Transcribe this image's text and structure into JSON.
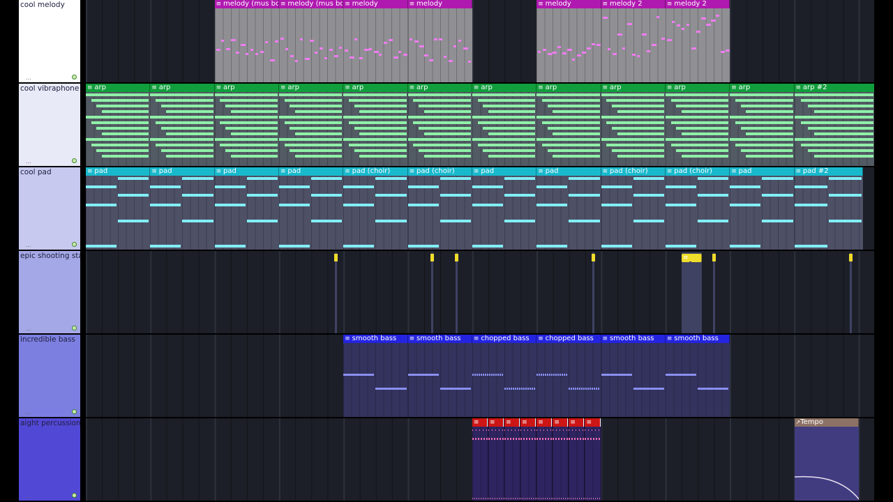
{
  "colors": {
    "melody_label": "#b019b0",
    "melody_body": "#8f8f94",
    "melody_note": "#f07cf0",
    "arp_label": "#119e3c",
    "arp_body": "#525a63",
    "arp_note": "#8ff0a8",
    "pad_label": "#19b9cc",
    "pad_body": "#4e5066",
    "pad_note": "#82eef5",
    "stars_marker": "#f0dc2a",
    "stars_body": "#3f4263",
    "bass_label": "#2424e0",
    "bass_body": "#33335e",
    "bass_note": "#8a8ff0",
    "perc_label": "#cc1616",
    "perc_body": "#2e2460",
    "perc_note": "#d070b0",
    "tempo_label": "#8c7266",
    "tempo_body": "#413c80",
    "tempo_curve": "#e8e0f0"
  },
  "tracks": [
    {
      "name": "cool melody",
      "header_color": "#ffffff",
      "patterns": [
        {
          "label": "melody (mus box)",
          "start": 8,
          "length": 4
        },
        {
          "label": "melody (mus box)",
          "start": 12,
          "length": 4
        },
        {
          "label": "melody",
          "start": 16,
          "length": 4
        },
        {
          "label": "melody",
          "start": 20,
          "length": 4
        },
        {
          "label": "melody",
          "start": 28,
          "length": 4
        },
        {
          "label": "melody 2",
          "start": 32,
          "length": 4
        },
        {
          "label": "melody 2",
          "start": 36,
          "length": 4
        }
      ]
    },
    {
      "name": "cool vibraphone",
      "header_color": "#e8eaf7",
      "patterns": [
        {
          "label": "arp",
          "start": 0,
          "length": 4
        },
        {
          "label": "arp",
          "start": 4,
          "length": 4
        },
        {
          "label": "arp",
          "start": 8,
          "length": 4
        },
        {
          "label": "arp",
          "start": 12,
          "length": 4
        },
        {
          "label": "arp",
          "start": 16,
          "length": 4
        },
        {
          "label": "arp",
          "start": 20,
          "length": 4
        },
        {
          "label": "arp",
          "start": 24,
          "length": 4
        },
        {
          "label": "arp",
          "start": 28,
          "length": 4
        },
        {
          "label": "arp",
          "start": 32,
          "length": 4
        },
        {
          "label": "arp",
          "start": 36,
          "length": 4
        },
        {
          "label": "arp",
          "start": 40,
          "length": 4
        },
        {
          "label": "arp #2",
          "start": 44,
          "length": 5
        }
      ]
    },
    {
      "name": "cool pad",
      "header_color": "#c7c9ef",
      "patterns": [
        {
          "label": "pad",
          "start": 0,
          "length": 4
        },
        {
          "label": "pad",
          "start": 4,
          "length": 4
        },
        {
          "label": "pad",
          "start": 8,
          "length": 4
        },
        {
          "label": "pad",
          "start": 12,
          "length": 4
        },
        {
          "label": "pad (choir)",
          "start": 16,
          "length": 4
        },
        {
          "label": "pad (choir)",
          "start": 20,
          "length": 4
        },
        {
          "label": "pad",
          "start": 24,
          "length": 4
        },
        {
          "label": "pad",
          "start": 28,
          "length": 4
        },
        {
          "label": "pad (choir)",
          "start": 32,
          "length": 4
        },
        {
          "label": "pad (choir)",
          "start": 36,
          "length": 4
        },
        {
          "label": "pad",
          "start": 40,
          "length": 4
        },
        {
          "label": "pad #2",
          "start": 44,
          "length": 4.25
        }
      ]
    },
    {
      "name": "epic shooting stars",
      "header_color": "#a5a8e6",
      "markers": [
        15.5,
        21.5,
        23,
        31.5,
        37.5,
        39,
        47.5
      ],
      "patterns": [
        {
          "label": "",
          "start": 37,
          "length": 1.25
        }
      ]
    },
    {
      "name": "incredible bass",
      "header_color": "#7c7fe0",
      "patterns": [
        {
          "label": "smooth bass",
          "start": 16,
          "length": 4
        },
        {
          "label": "smooth bass",
          "start": 20,
          "length": 4
        },
        {
          "label": "chopped bass",
          "start": 24,
          "length": 4
        },
        {
          "label": "chopped bass",
          "start": 28,
          "length": 4
        },
        {
          "label": "smooth bass",
          "start": 32,
          "length": 4
        },
        {
          "label": "smooth bass",
          "start": 36,
          "length": 4
        }
      ]
    },
    {
      "name": "aight percussion",
      "header_color": "#5248d6",
      "patterns": [
        {
          "label": "",
          "start": 24,
          "length": 1
        },
        {
          "label": "",
          "start": 25,
          "length": 1
        },
        {
          "label": "",
          "start": 26,
          "length": 1
        },
        {
          "label": "",
          "start": 27,
          "length": 1
        },
        {
          "label": "",
          "start": 28,
          "length": 1
        },
        {
          "label": "",
          "start": 29,
          "length": 1
        },
        {
          "label": "",
          "start": 30,
          "length": 1
        },
        {
          "label": "",
          "start": 31,
          "length": 1
        }
      ],
      "automation": {
        "label": "Tempo",
        "start": 44,
        "length": 4
      }
    }
  ]
}
